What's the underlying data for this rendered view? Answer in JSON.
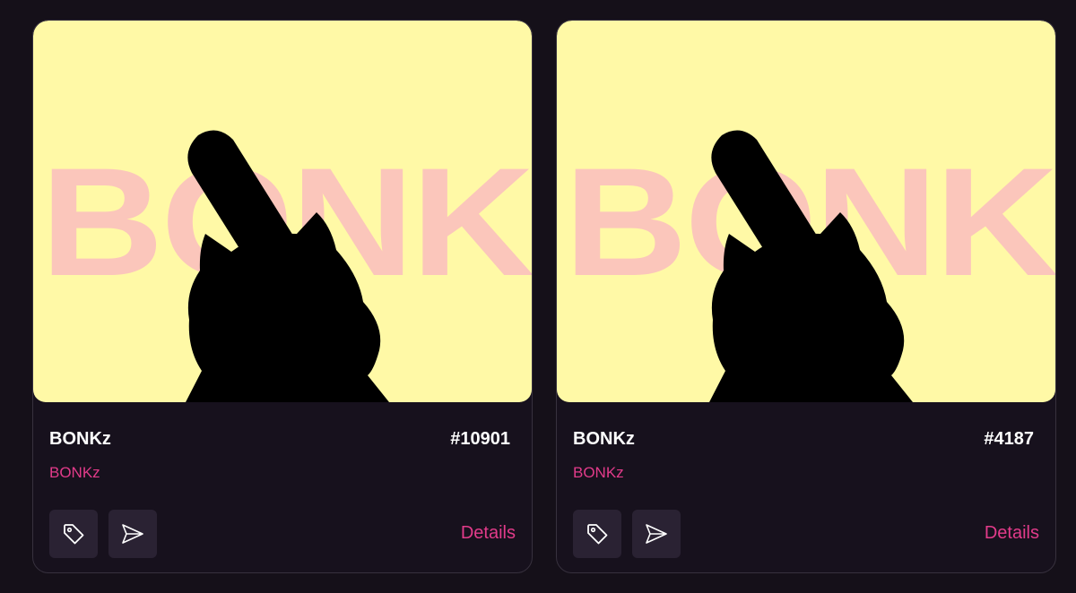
{
  "colors": {
    "background": "#151019",
    "card": "#17111d",
    "accent": "#e23b8a",
    "artwork_background": "#fff9a6",
    "artwork_text": "#fbc6bb"
  },
  "cards": [
    {
      "artwork_text": "BONK",
      "name": "BONKz",
      "token_id": "#10901",
      "collection": "BONKz",
      "list_icon": "tag-icon",
      "send_icon": "send-icon",
      "details_label": "Details"
    },
    {
      "artwork_text": "BONK",
      "name": "BONKz",
      "token_id": "#4187",
      "collection": "BONKz",
      "list_icon": "tag-icon",
      "send_icon": "send-icon",
      "details_label": "Details"
    }
  ]
}
